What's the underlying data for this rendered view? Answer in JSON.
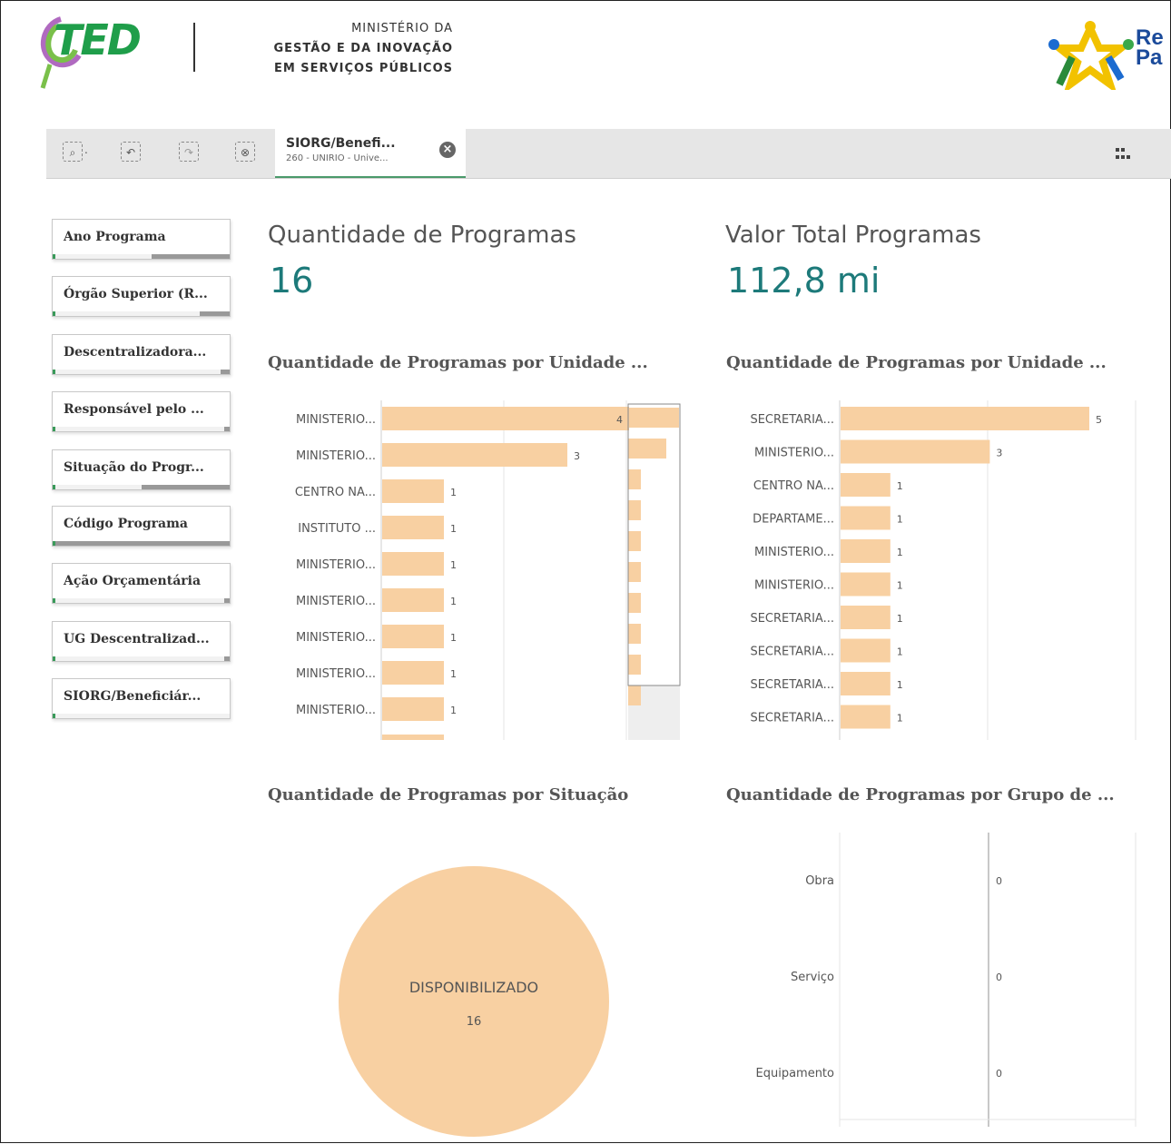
{
  "header": {
    "logo_text": "TED",
    "ministry_line1": "MINISTÉRIO DA",
    "ministry_line2": "GESTÃO E DA INOVAÇÃO",
    "ministry_line3": "EM SERVIÇOS PÚBLICOS",
    "gov_logo_text_1": "Re",
    "gov_logo_text_2": "Pa"
  },
  "toolbar": {
    "icons": [
      "smart-search-icon",
      "step-back-icon",
      "step-forward-icon",
      "clear-selections-icon"
    ],
    "selection_title": "SIORG/Benefi...",
    "selection_value": "260 - UNIRIO - Unive...",
    "sheets_icon": "grid-icon"
  },
  "filters": [
    {
      "label": "Ano Programa",
      "fill": 0.44
    },
    {
      "label": "Órgão Superior (R...",
      "fill": 0.17
    },
    {
      "label": "Descentralizadora...",
      "fill": 0.05
    },
    {
      "label": "Responsável pelo ...",
      "fill": 0.03
    },
    {
      "label": "Situação do Progr...",
      "fill": 0.5
    },
    {
      "label": "Código Programa",
      "fill": 1.0
    },
    {
      "label": "Ação Orçamentária",
      "fill": 0.03
    },
    {
      "label": "UG Descentralizad...",
      "fill": 0.03
    },
    {
      "label": "SIORG/Beneficiár...",
      "fill": 0.0,
      "selected": true
    }
  ],
  "kpis": [
    {
      "title": "Quantidade de Programas",
      "value": "16"
    },
    {
      "title": "Valor Total Programas",
      "value": "112,8 mi"
    }
  ],
  "chart_titles": {
    "c1": "Quantidade de Programas por Unidade ...",
    "c2": "Quantidade de Programas por Unidade ...",
    "c3": "Quantidade de Programas por Situação",
    "c4": "Quantidade de Programas por Grupo de ..."
  },
  "chart_data": [
    {
      "type": "bar",
      "orientation": "horizontal",
      "title": "Quantidade de Programas por Unidade ...",
      "categories": [
        "MINISTERIO...",
        "MINISTERIO...",
        "CENTRO NA...",
        "INSTITUTO ...",
        "MINISTERIO...",
        "MINISTERIO...",
        "MINISTERIO...",
        "MINISTERIO...",
        "MINISTERIO..."
      ],
      "values": [
        4,
        3,
        1,
        1,
        1,
        1,
        1,
        1,
        1
      ],
      "xlim": [
        0,
        4
      ],
      "color": "#f8d0a2",
      "scrollbar": true
    },
    {
      "type": "bar",
      "orientation": "horizontal",
      "title": "Quantidade de Programas por Unidade ...",
      "categories": [
        "SECRETARIA...",
        "MINISTERIO...",
        "CENTRO NA...",
        "DEPARTAME...",
        "MINISTERIO...",
        "MINISTERIO...",
        "SECRETARIA...",
        "SECRETARIA...",
        "SECRETARIA...",
        "SECRETARIA..."
      ],
      "values": [
        5,
        3,
        1,
        1,
        1,
        1,
        1,
        1,
        1,
        1
      ],
      "xlim": [
        0,
        5
      ],
      "color": "#f8d0a2"
    },
    {
      "type": "pie",
      "title": "Quantidade de Programas por Situação",
      "slices": [
        {
          "label": "DISPONIBILIZADO",
          "value": 16
        }
      ],
      "color": "#f8d0a2"
    },
    {
      "type": "bar",
      "orientation": "horizontal",
      "title": "Quantidade de Programas por Grupo de ...",
      "categories": [
        "Obra",
        "Serviço",
        "Equipamento"
      ],
      "values": [
        0,
        0,
        0
      ],
      "color": "#f8d0a2"
    }
  ]
}
